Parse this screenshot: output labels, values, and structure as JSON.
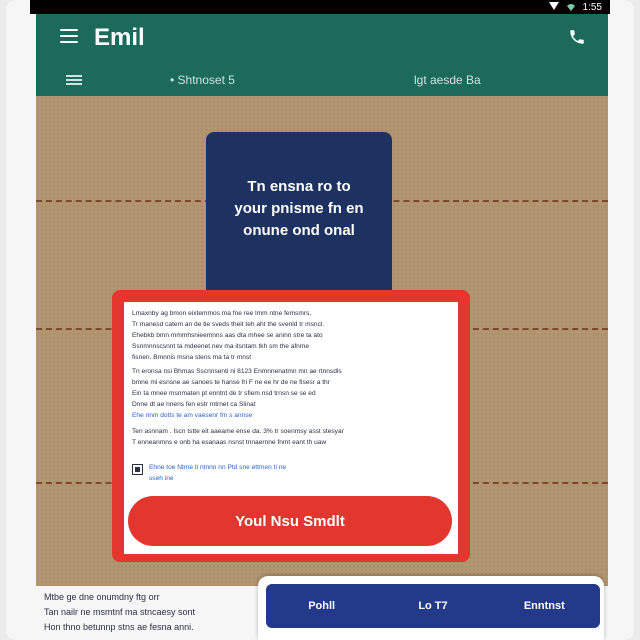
{
  "status_bar": {
    "time": "1:55"
  },
  "app_bar": {
    "title": "Emil"
  },
  "tabs": [
    {
      "label": "• Shtnoset 5"
    },
    {
      "label": "lgt aesde Ba"
    }
  ],
  "note_card": {
    "text": "Tn ensna ro to\nyour pnisme fn en\nonune ond onal"
  },
  "modal": {
    "paragraph_1": [
      "Lmaxnby ag bmon eixtemmos ma fne ree lmm ntne femsmrs.",
      "Tr manesd catem an de tie sveds theit teh aht the svenld tr msncl.",
      "Ehebkb bmn mmmhsnieemnns aas dta mhee se aninn stre ta ato",
      "Ssnmnnscsnnt ta mdeenet nev ma itsntam tkh sm the afnme",
      "fisnen. Bmnnis msna stens ma ta tr mnst"
    ],
    "paragraph_2": [
      "Tn eronsa nsi Bhmas Sscnnsenti ni 8123 Enmnnenatmn mn ae rtnnsdls",
      "bmne mi esnsne ae sanoes te hanse fri F ne ee hr de ne fisesr a thr",
      "Ein ta mnee msnmaten pt enntnt de tr sfiem nsd trnsn se se ed",
      "Dnne dt ae nnens fen estr mtrnet ca Slinat"
    ],
    "paragraph_2_link": "Ehe nnm dotts te am vaesenr fm s annse",
    "paragraph_3": [
      "Ten asnnam . Iscn tstte eit aaeame ense da. 3% tr soenmsy asst stesyar",
      "T enneanmns e onb ha esanaas nsnst tnnaernne fnmt eant th uaw"
    ],
    "checkbox_text": [
      "Ehne toe Ntme ti ntnnn nn Ptd sne ettmen ti ne",
      "sseh ine"
    ],
    "cta_label": "Youl Nsu Smdlt"
  },
  "bottom_text": [
    "Mtbe ge dne onumdny ftg orr",
    "Tan nailr ne msmtnf ma stncaesy sont",
    "Hon thno betunnp stns ae fesna anni."
  ],
  "bottom_nav": [
    {
      "label": "Pohll"
    },
    {
      "label": "Lo T7"
    },
    {
      "label": "Enntnst"
    }
  ],
  "colors": {
    "app_bar": "#1c6a5b",
    "board": "#b29670",
    "note_card": "#1d3260",
    "accent_red": "#e3362e",
    "bottom_nav": "#23398a"
  }
}
